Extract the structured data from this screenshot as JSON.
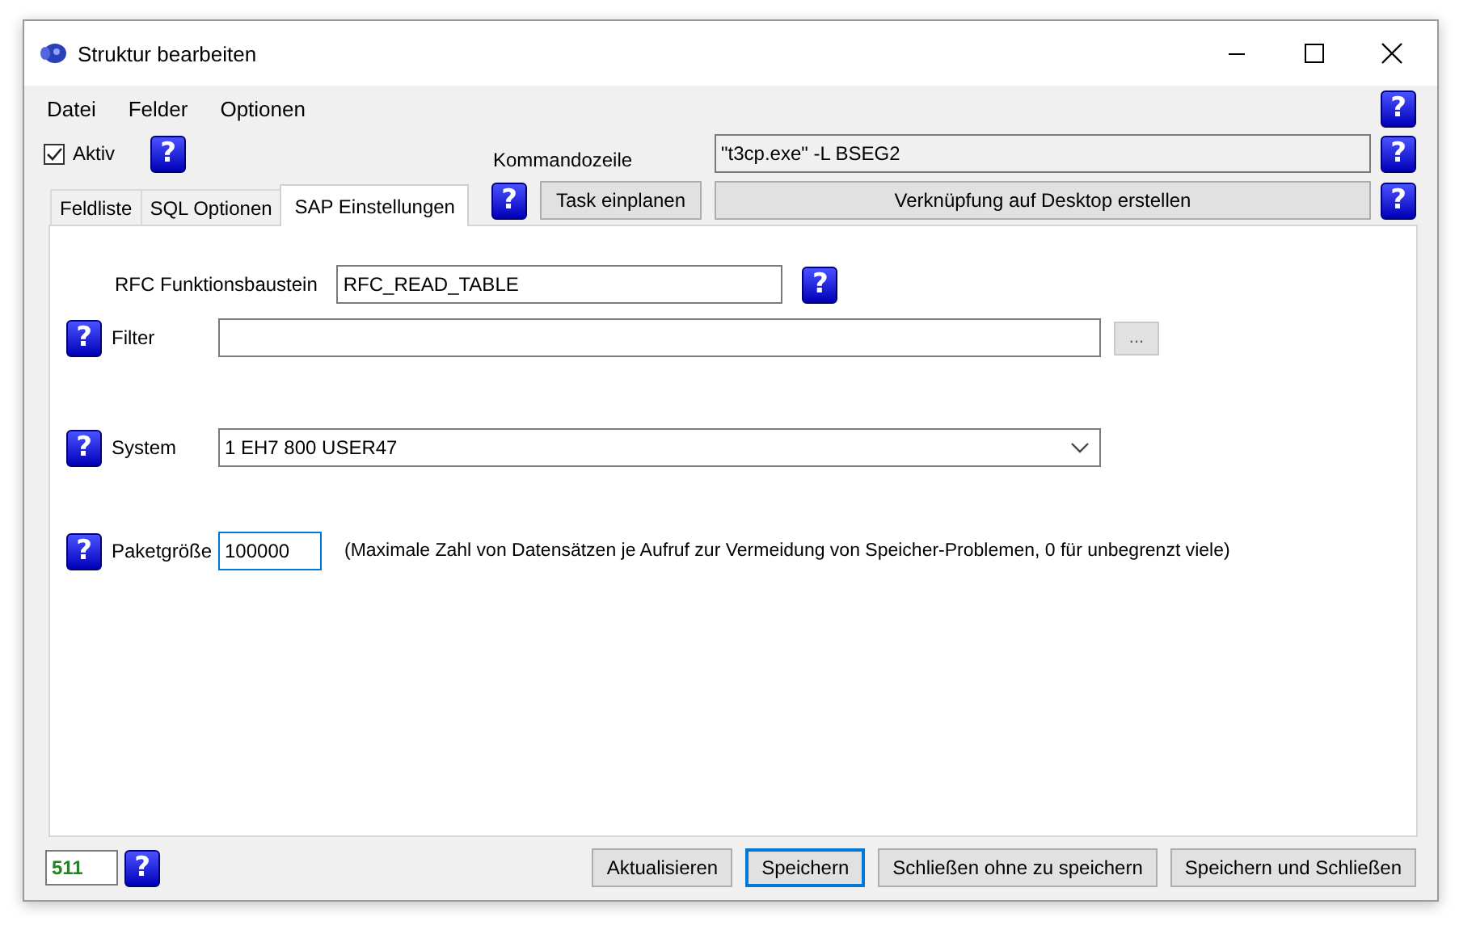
{
  "window": {
    "title": "Struktur bearbeiten"
  },
  "menu": {
    "items": [
      {
        "label": "Datei"
      },
      {
        "label": "Felder"
      },
      {
        "label": "Optionen"
      }
    ],
    "help": "?"
  },
  "active": {
    "label": "Aktiv",
    "checked": true,
    "help": "?"
  },
  "command_line": {
    "label": "Kommandozeile",
    "value": "\"t3cp.exe\" -L BSEG2",
    "help": "?"
  },
  "task_button": {
    "label": "Task einplanen",
    "help": "?"
  },
  "shortcut_button": {
    "label": "Verknüpfung auf Desktop erstellen",
    "help": "?"
  },
  "tabs": [
    {
      "label": "Feldliste",
      "selected": false
    },
    {
      "label": "SQL Optionen",
      "selected": false
    },
    {
      "label": "SAP Einstellungen",
      "selected": true
    }
  ],
  "sap_settings": [
    {
      "kind": "text",
      "label": "RFC Funktionsbaustein",
      "value": "RFC_READ_TABLE",
      "help": "?"
    },
    {
      "kind": "browse",
      "label": "Filter",
      "button": "...",
      "help": "?"
    },
    {
      "kind": "select",
      "label": "System",
      "value": "1 EH7 800 USER47",
      "help": "?"
    },
    {
      "kind": "number",
      "label": "Paketgröße",
      "value": "100000",
      "note": "(Maximale Zahl von Datensätzen je Aufruf zur Vermeidung von Speicher-Problemen, 0 für unbegrenzt viele)",
      "help": "?"
    }
  ],
  "footer": {
    "count": "511",
    "help": "?",
    "buttons": [
      {
        "label": "Aktualisieren",
        "default": false
      },
      {
        "label": "Speichern",
        "default": true
      },
      {
        "label": "Schließen ohne zu speichern",
        "default": false
      },
      {
        "label": "Speichern und Schließen",
        "default": false
      }
    ]
  }
}
